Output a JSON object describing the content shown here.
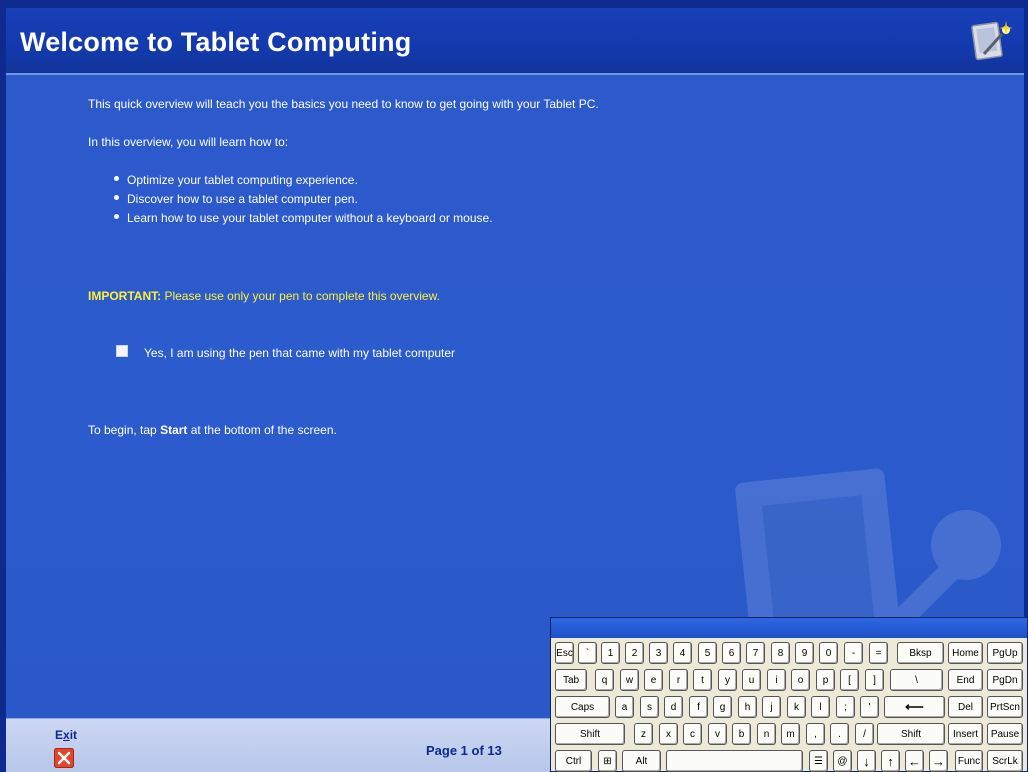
{
  "header": {
    "title": "Welcome to Tablet Computing",
    "logo_icon": "tablet-pen-logo-icon"
  },
  "content": {
    "intro": "This quick overview will teach you the basics you need to know to get going with your Tablet PC.",
    "learn_lead": "In this overview, you will learn how to:",
    "bullets": [
      "Optimize your tablet computing experience.",
      "Discover how to use a tablet computer pen.",
      "Learn how to use your tablet computer without a keyboard or mouse."
    ],
    "important_label": "IMPORTANT:",
    "important_text": " Please use only your pen to complete this overview.",
    "checkbox_label": "Yes, I am using the pen that came with my tablet computer",
    "checkbox_checked": false,
    "begin_prefix": "To begin, tap ",
    "begin_bold": "Start",
    "begin_suffix": " at the bottom of the screen."
  },
  "footer": {
    "exit_label_prefix": "E",
    "exit_label_underlined": "x",
    "exit_label_suffix": "it",
    "exit_icon": "close-x-icon",
    "page_indicator": "Page 1 of 13"
  },
  "keyboard": {
    "rows": [
      [
        "Esc",
        "`",
        "1",
        "2",
        "3",
        "4",
        "5",
        "6",
        "7",
        "8",
        "9",
        "0",
        "-",
        "=",
        "Bksp",
        "Home",
        "PgUp"
      ],
      [
        "Tab",
        "q",
        "w",
        "e",
        "r",
        "t",
        "y",
        "u",
        "i",
        "o",
        "p",
        "[",
        "]",
        "\\",
        "End",
        "PgDn"
      ],
      [
        "Caps",
        "a",
        "s",
        "d",
        "f",
        "g",
        "h",
        "j",
        "k",
        "l",
        ";",
        "'",
        "⟵",
        "Del",
        "PrtScn"
      ],
      [
        "Shift",
        "z",
        "x",
        "c",
        "v",
        "b",
        "n",
        "m",
        ",",
        ".",
        "/",
        "Shift",
        "Insert",
        "Pause"
      ],
      [
        "Ctrl",
        "⊞",
        "Alt",
        "",
        "☰",
        "@",
        "↓",
        "↑",
        "←",
        "→",
        "Func",
        "ScrLk"
      ]
    ]
  },
  "colors": {
    "header_bg": "#1339ad",
    "content_bg": "#2b5bcd",
    "important": "#ffef3a",
    "footer_bg": "#c4d1ef"
  }
}
